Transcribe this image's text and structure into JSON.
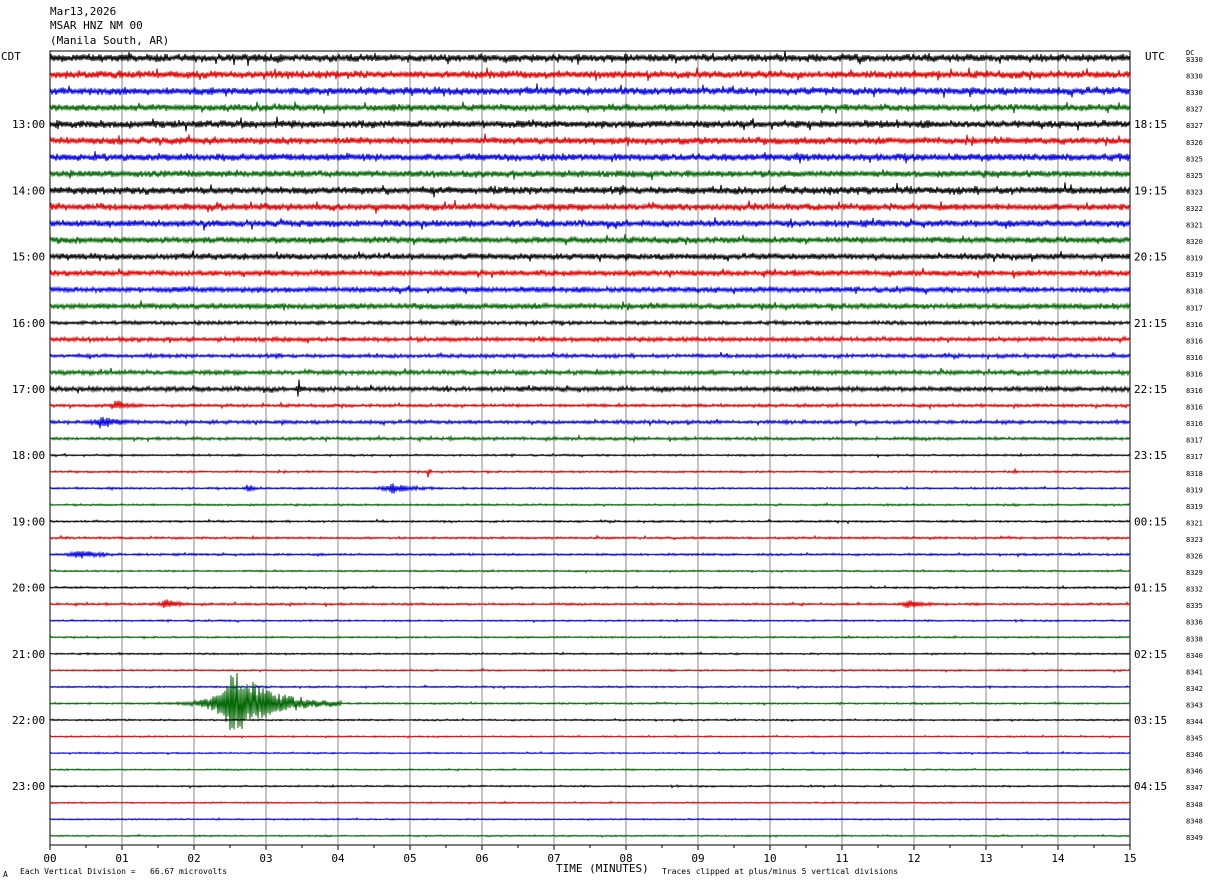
{
  "header": {
    "date": "Mar13,2026",
    "station": "MSAR HNZ NM 00",
    "location": "(Manila South, AR)"
  },
  "left_timezone": "CDT",
  "right_timezone": "UTC",
  "dc_label": "DC",
  "footer": {
    "division_note": "Each Vertical Division =   66.67 microvolts",
    "clip_note": "Traces clipped at plus/minus 5 vertical divisions",
    "corner_mark": "A"
  },
  "colors": {
    "trace_cycle": [
      "#000000",
      "#dd0000",
      "#0000dd",
      "#006600"
    ],
    "grid": "#888888"
  },
  "chart_data": {
    "type": "line",
    "title": "MSAR HNZ NM 00",
    "xlabel": "TIME (MINUTES)",
    "ylabel": "",
    "xlim": [
      0,
      15
    ],
    "x_ticks": [
      "00",
      "01",
      "02",
      "03",
      "04",
      "05",
      "06",
      "07",
      "08",
      "09",
      "10",
      "11",
      "12",
      "13",
      "14",
      "15"
    ],
    "left_hour_labels": [
      {
        "row": 4,
        "label": "13:00"
      },
      {
        "row": 8,
        "label": "14:00"
      },
      {
        "row": 12,
        "label": "15:00"
      },
      {
        "row": 16,
        "label": "16:00"
      },
      {
        "row": 20,
        "label": "17:00"
      },
      {
        "row": 24,
        "label": "18:00"
      },
      {
        "row": 28,
        "label": "19:00"
      },
      {
        "row": 32,
        "label": "20:00"
      },
      {
        "row": 36,
        "label": "21:00"
      },
      {
        "row": 40,
        "label": "22:00"
      },
      {
        "row": 44,
        "label": "23:00"
      }
    ],
    "right_hour_labels": [
      {
        "row": 4,
        "label": "18:15"
      },
      {
        "row": 8,
        "label": "19:15"
      },
      {
        "row": 12,
        "label": "20:15"
      },
      {
        "row": 16,
        "label": "21:15"
      },
      {
        "row": 20,
        "label": "22:15"
      },
      {
        "row": 24,
        "label": "23:15"
      },
      {
        "row": 28,
        "label": "00:15"
      },
      {
        "row": 32,
        "label": "01:15"
      },
      {
        "row": 36,
        "label": "02:15"
      },
      {
        "row": 40,
        "label": "03:15"
      },
      {
        "row": 44,
        "label": "04:15"
      }
    ],
    "dc_offsets": [
      "8330",
      "8330",
      "8330",
      "8327",
      "8327",
      "8326",
      "8325",
      "8325",
      "8323",
      "8322",
      "8321",
      "8320",
      "8319",
      "8319",
      "8318",
      "8317",
      "8316",
      "8316",
      "8316",
      "8316",
      "8316",
      "8316",
      "8316",
      "8317",
      "8317",
      "8318",
      "8319",
      "8319",
      "8321",
      "8323",
      "8326",
      "8329",
      "8332",
      "8335",
      "8336",
      "8338",
      "8340",
      "8341",
      "8342",
      "8343",
      "8344",
      "8345",
      "8346",
      "8346",
      "8347",
      "8348",
      "8348",
      "8349"
    ],
    "trace_noise": [
      3.5,
      3.3,
      3.4,
      3.0,
      3.3,
      3.1,
      3.3,
      2.9,
      3.4,
      3.0,
      3.0,
      2.8,
      2.7,
      2.4,
      2.4,
      2.5,
      1.6,
      1.9,
      1.6,
      1.9,
      2.1,
      1.3,
      1.5,
      1.3,
      0.8,
      0.8,
      0.8,
      0.8,
      0.8,
      0.9,
      0.9,
      0.7,
      0.8,
      0.9,
      0.7,
      0.7,
      0.7,
      0.7,
      0.7,
      0.7,
      0.7,
      0.6,
      0.6,
      0.6,
      0.7,
      0.6,
      0.6,
      0.6
    ],
    "events": [
      {
        "row": 20,
        "minute": 3.45,
        "amplitude": 9,
        "duration": 0.1
      },
      {
        "row": 21,
        "minute": 0.9,
        "amplitude": 5,
        "duration": 0.4
      },
      {
        "row": 22,
        "minute": 0.7,
        "amplitude": 6,
        "duration": 0.5
      },
      {
        "row": 25,
        "minute": 5.25,
        "amplitude": 6,
        "duration": 0.05
      },
      {
        "row": 25,
        "minute": 13.4,
        "amplitude": 4,
        "duration": 0.05
      },
      {
        "row": 26,
        "minute": 2.75,
        "amplitude": 5,
        "duration": 0.2
      },
      {
        "row": 26,
        "minute": 4.75,
        "amplitude": 6,
        "duration": 0.6
      },
      {
        "row": 30,
        "minute": 0.4,
        "amplitude": 5,
        "duration": 0.6
      },
      {
        "row": 33,
        "minute": 1.6,
        "amplitude": 5,
        "duration": 0.4
      },
      {
        "row": 33,
        "minute": 11.9,
        "amplitude": 5,
        "duration": 0.4
      },
      {
        "row": 39,
        "minute": 2.55,
        "amplitude": 34,
        "duration": 1.5
      }
    ]
  }
}
